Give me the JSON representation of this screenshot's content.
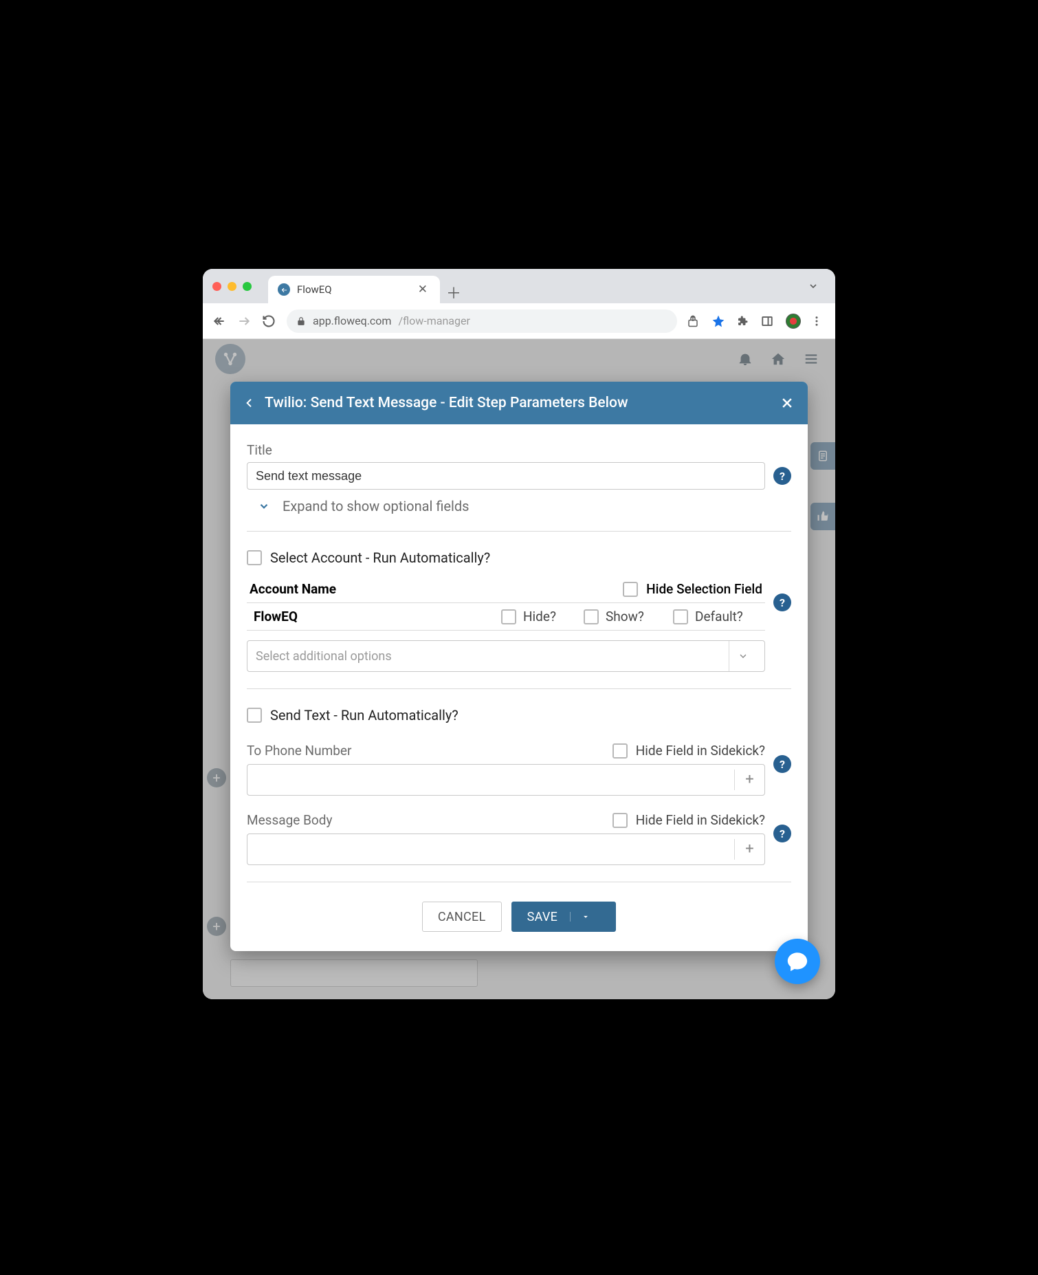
{
  "browser": {
    "tab_title": "FlowEQ",
    "url_host": "app.floweq.com",
    "url_path": "/flow-manager"
  },
  "modal": {
    "title": "Twilio: Send Text Message - Edit Step Parameters Below",
    "title_label": "Title",
    "title_value": "Send text message",
    "expand_label": "Expand to show optional fields",
    "section1": {
      "run_auto": "Select Account - Run Automatically?",
      "col_account_name": "Account Name",
      "hide_selection": "Hide Selection Field",
      "row_name": "FlowEQ",
      "hide": "Hide?",
      "show": "Show?",
      "default": "Default?",
      "select_placeholder": "Select additional options"
    },
    "section2": {
      "run_auto": "Send Text - Run Automatically?",
      "phone_label": "To Phone Number",
      "hide_field": "Hide Field in Sidekick?",
      "body_label": "Message Body"
    },
    "footer": {
      "cancel": "CANCEL",
      "save": "SAVE"
    }
  }
}
